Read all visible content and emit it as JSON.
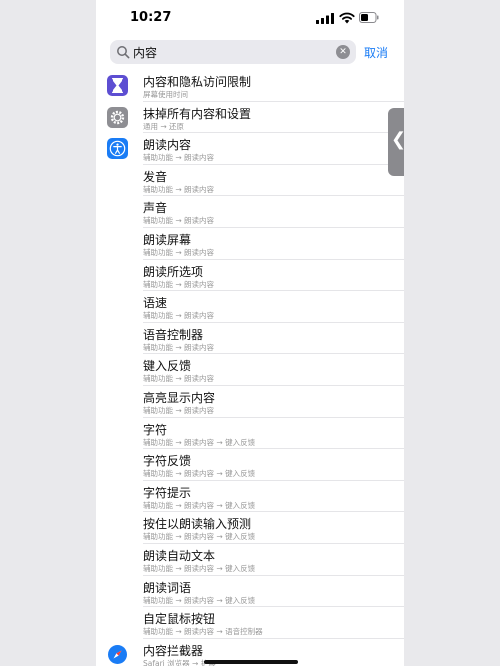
{
  "status": {
    "time": "10:27"
  },
  "search": {
    "value": "内容",
    "cancel": "取消"
  },
  "results": [
    {
      "title": "内容和隐私访问限制",
      "subtitle": "屏幕使用时间",
      "icon": "hourglass-icon",
      "color": "#5d4ed2"
    },
    {
      "title": "抹掉所有内容和设置",
      "subtitle": "通用 → 还原",
      "icon": "gear-icon",
      "color": "#8e8e93"
    },
    {
      "title": "朗读内容",
      "subtitle": "辅助功能 → 朗读内容",
      "icon": "accessibility-icon",
      "color": "#1a7cf5"
    },
    {
      "title": "发音",
      "subtitle": "辅助功能 → 朗读内容"
    },
    {
      "title": "声音",
      "subtitle": "辅助功能 → 朗读内容"
    },
    {
      "title": "朗读屏幕",
      "subtitle": "辅助功能 → 朗读内容"
    },
    {
      "title": "朗读所选项",
      "subtitle": "辅助功能 → 朗读内容"
    },
    {
      "title": "语速",
      "subtitle": "辅助功能 → 朗读内容"
    },
    {
      "title": "语音控制器",
      "subtitle": "辅助功能 → 朗读内容"
    },
    {
      "title": "键入反馈",
      "subtitle": "辅助功能 → 朗读内容"
    },
    {
      "title": "高亮显示内容",
      "subtitle": "辅助功能 → 朗读内容"
    },
    {
      "title": "字符",
      "subtitle": "辅助功能 → 朗读内容 → 键入反馈"
    },
    {
      "title": "字符反馈",
      "subtitle": "辅助功能 → 朗读内容 → 键入反馈"
    },
    {
      "title": "字符提示",
      "subtitle": "辅助功能 → 朗读内容 → 键入反馈"
    },
    {
      "title": "按住以朗读输入预测",
      "subtitle": "辅助功能 → 朗读内容 → 键入反馈"
    },
    {
      "title": "朗读自动文本",
      "subtitle": "辅助功能 → 朗读内容 → 键入反馈"
    },
    {
      "title": "朗读词语",
      "subtitle": "辅助功能 → 朗读内容 → 键入反馈"
    },
    {
      "title": "自定鼠标按钮",
      "subtitle": "辅助功能 → 朗读内容 → 语音控制器"
    },
    {
      "title": "内容拦截器",
      "subtitle": "Safari 浏览器 → 扩展",
      "icon": "safari-icon",
      "color": "#1a7cf5"
    }
  ]
}
